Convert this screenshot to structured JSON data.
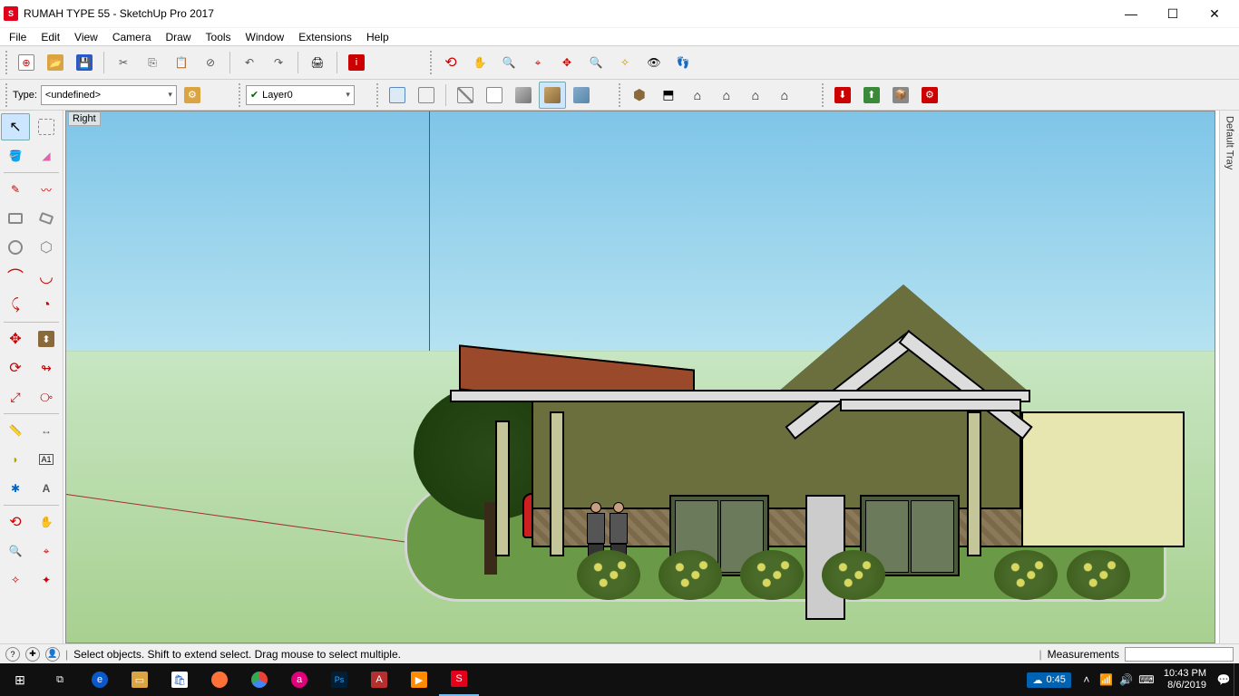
{
  "titlebar": {
    "title": "RUMAH TYPE 55 - SketchUp Pro 2017"
  },
  "menubar": [
    "File",
    "Edit",
    "View",
    "Camera",
    "Draw",
    "Tools",
    "Window",
    "Extensions",
    "Help"
  ],
  "toolbar1": {
    "type_label": "Type:",
    "type_value": "<undefined>",
    "layer_value": "Layer0"
  },
  "viewport": {
    "view_label": "Right"
  },
  "tray": {
    "label": "Default Tray"
  },
  "statusbar": {
    "hint": "Select objects. Shift to extend select. Drag mouse to select multiple.",
    "measurements_label": "Measurements"
  },
  "taskbar": {
    "weather": "0:45",
    "time": "10:43 PM",
    "date": "8/6/2019"
  }
}
